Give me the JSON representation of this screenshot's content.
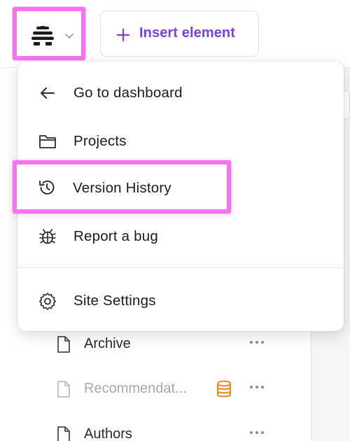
{
  "topbar": {
    "logo_icon": "beehive-logo-icon",
    "logo_chevron_icon": "chevron-down-icon",
    "insert_button": {
      "icon": "plus-icon",
      "label": "Insert element"
    }
  },
  "menu": {
    "items": [
      {
        "label": "Go to dashboard",
        "icon": "arrow-left-icon"
      },
      {
        "label": "Projects",
        "icon": "folder-icon"
      },
      {
        "label": "Version History",
        "icon": "history-icon"
      },
      {
        "label": "Report a bug",
        "icon": "bug-icon"
      },
      {
        "label": "Site Settings",
        "icon": "gear-icon"
      }
    ]
  },
  "pages": [
    {
      "name": "Archive",
      "icon": "document-icon",
      "dimmed": false
    },
    {
      "name": "Recommendat...",
      "icon": "document-icon",
      "dimmed": true,
      "badge_icon": "database-icon"
    },
    {
      "name": "Authors",
      "icon": "document-icon",
      "dimmed": false
    }
  ],
  "colors": {
    "accent": "#7b3fe4",
    "highlight": "#f374f0",
    "badge": "#e8891e"
  }
}
